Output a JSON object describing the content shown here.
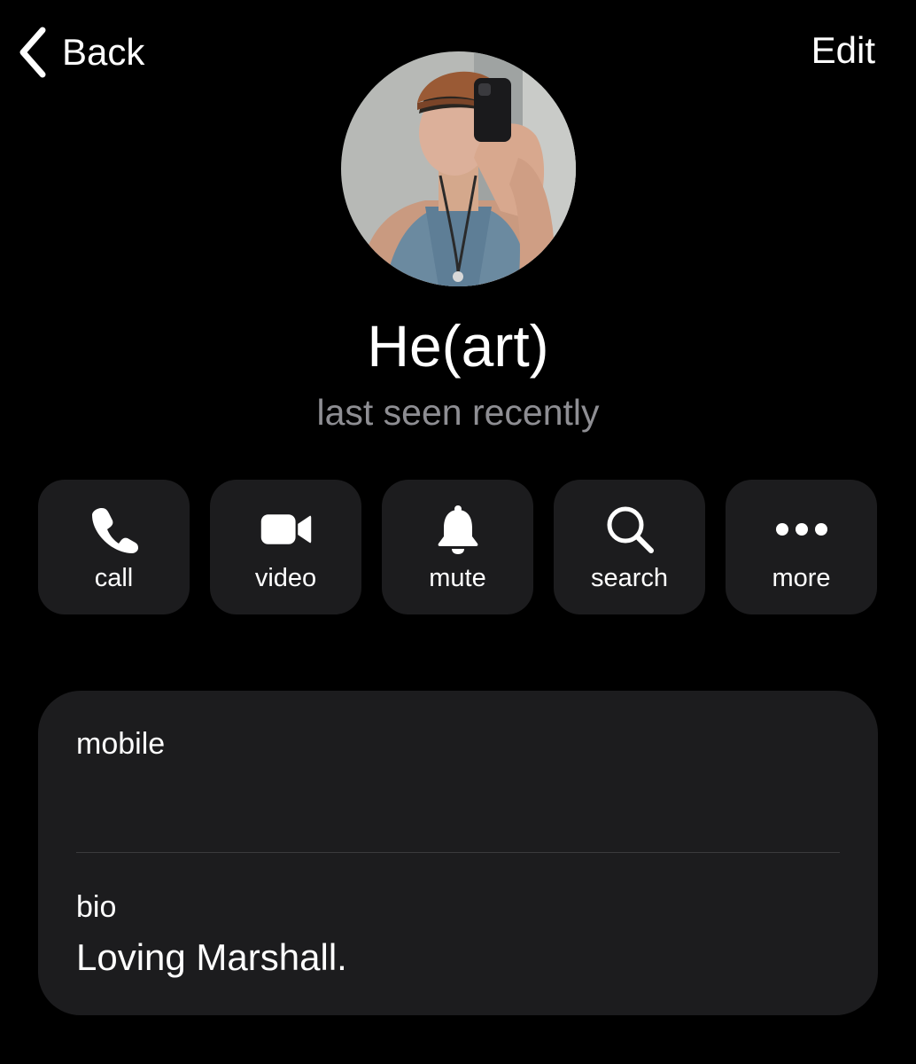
{
  "nav": {
    "back_label": "Back",
    "edit_label": "Edit"
  },
  "profile": {
    "name": "He(art)",
    "status": "last seen recently",
    "avatar": "user-photo"
  },
  "actions": [
    {
      "label": "call",
      "icon": "phone-icon"
    },
    {
      "label": "video",
      "icon": "video-camera-icon"
    },
    {
      "label": "mute",
      "icon": "bell-icon"
    },
    {
      "label": "search",
      "icon": "magnifier-icon"
    },
    {
      "label": "more",
      "icon": "ellipsis-icon"
    }
  ],
  "info": {
    "mobile_label": "mobile",
    "mobile_value": "",
    "bio_label": "bio",
    "bio_value": "Loving Marshall."
  },
  "colors": {
    "background": "#000000",
    "card": "#1c1c1e",
    "secondary_text": "#8e8e93",
    "text": "#ffffff"
  }
}
